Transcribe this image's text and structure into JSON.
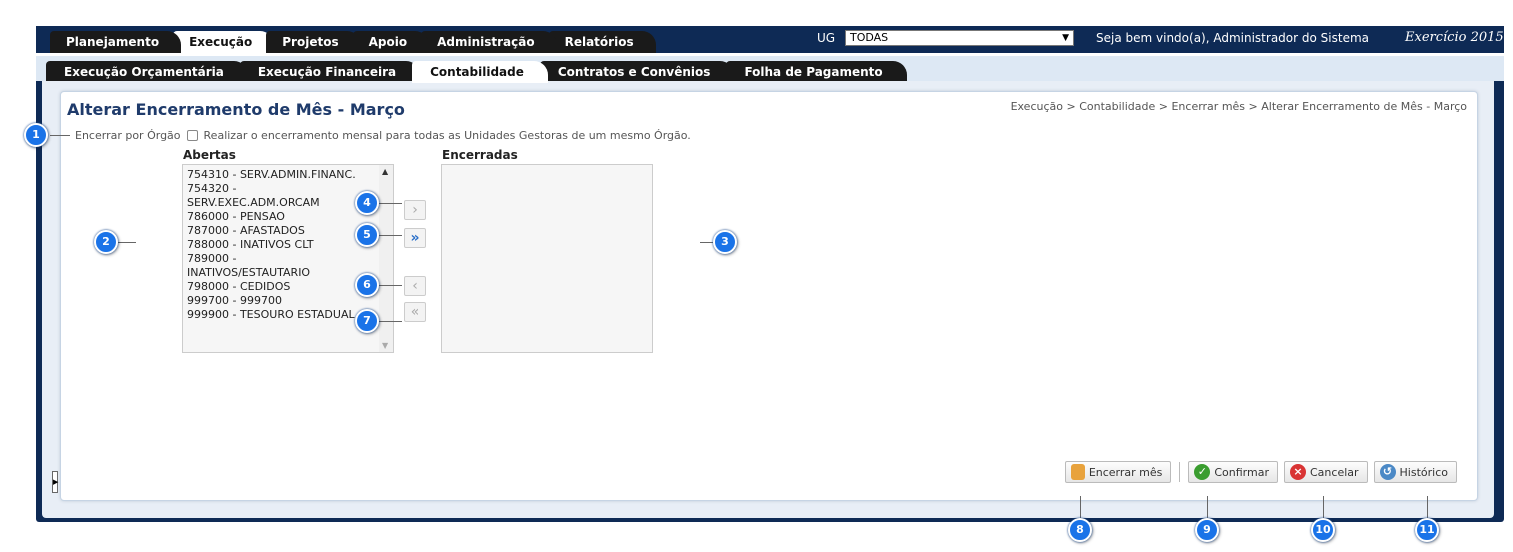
{
  "main_tabs": [
    {
      "label": "Planejamento",
      "active": false
    },
    {
      "label": "Execução",
      "active": true
    },
    {
      "label": "Projetos",
      "active": false
    },
    {
      "label": "Apoio",
      "active": false
    },
    {
      "label": "Administração",
      "active": false
    },
    {
      "label": "Relatórios",
      "active": false
    }
  ],
  "header": {
    "ug_label": "UG",
    "ug_value": "TODAS",
    "welcome": "Seja bem vindo(a), Administrador do Sistema",
    "exercicio": "Exercício 2015"
  },
  "sub_tabs": [
    {
      "label": "Execução Orçamentária",
      "active": false
    },
    {
      "label": "Execução Financeira",
      "active": false
    },
    {
      "label": "Contabilidade",
      "active": true
    },
    {
      "label": "Contratos e Convênios",
      "active": false
    },
    {
      "label": "Folha de Pagamento",
      "active": false
    }
  ],
  "page": {
    "title": "Alterar Encerramento de Mês - Março",
    "breadcrumb": "Execução > Contabilidade > Encerrar mês > Alterar Encerramento de Mês - Março",
    "encerrar_label": "Encerrar por Órgão",
    "encerrar_desc": "Realizar o encerramento mensal para todas as Unidades Gestoras de um mesmo Órgão.",
    "abertas_label": "Abertas",
    "encerradas_label": "Encerradas",
    "abertas": [
      "754310 - SERV.ADMIN.FINANC.",
      "754320 -",
      "SERV.EXEC.ADM.ORCAM",
      "786000 - PENSAO",
      "787000 - AFASTADOS",
      "788000 - INATIVOS CLT",
      "789000 -",
      "INATIVOS/ESTAUTARIO",
      "798000 - CEDIDOS",
      "999700 - 999700",
      "999900 - TESOURO ESTADUAL"
    ]
  },
  "move_buttons": {
    "move_one_right": "›",
    "move_all_right": "»",
    "move_one_left": "‹",
    "move_all_left": "«"
  },
  "actions": {
    "encerrar": "Encerrar mês",
    "confirmar": "Confirmar",
    "cancelar": "Cancelar",
    "historico": "Histórico"
  },
  "callouts": [
    "1",
    "2",
    "3",
    "4",
    "5",
    "6",
    "7",
    "8",
    "9",
    "10",
    "11"
  ]
}
